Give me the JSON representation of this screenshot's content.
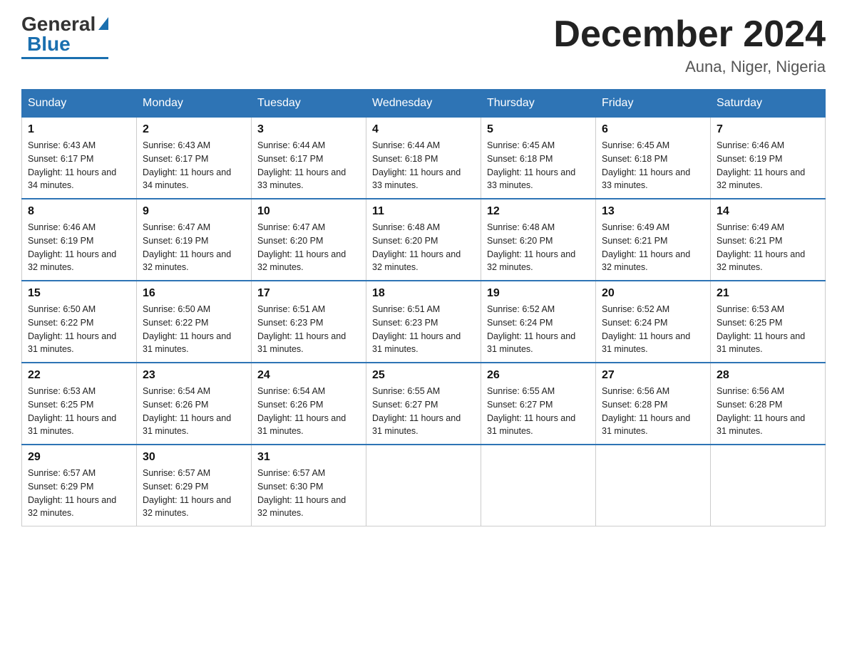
{
  "header": {
    "logo_general": "General",
    "logo_blue": "Blue",
    "title": "December 2024",
    "subtitle": "Auna, Niger, Nigeria"
  },
  "days_of_week": [
    "Sunday",
    "Monday",
    "Tuesday",
    "Wednesday",
    "Thursday",
    "Friday",
    "Saturday"
  ],
  "weeks": [
    [
      {
        "day": "1",
        "sunrise": "6:43 AM",
        "sunset": "6:17 PM",
        "daylight": "11 hours and 34 minutes."
      },
      {
        "day": "2",
        "sunrise": "6:43 AM",
        "sunset": "6:17 PM",
        "daylight": "11 hours and 34 minutes."
      },
      {
        "day": "3",
        "sunrise": "6:44 AM",
        "sunset": "6:17 PM",
        "daylight": "11 hours and 33 minutes."
      },
      {
        "day": "4",
        "sunrise": "6:44 AM",
        "sunset": "6:18 PM",
        "daylight": "11 hours and 33 minutes."
      },
      {
        "day": "5",
        "sunrise": "6:45 AM",
        "sunset": "6:18 PM",
        "daylight": "11 hours and 33 minutes."
      },
      {
        "day": "6",
        "sunrise": "6:45 AM",
        "sunset": "6:18 PM",
        "daylight": "11 hours and 33 minutes."
      },
      {
        "day": "7",
        "sunrise": "6:46 AM",
        "sunset": "6:19 PM",
        "daylight": "11 hours and 32 minutes."
      }
    ],
    [
      {
        "day": "8",
        "sunrise": "6:46 AM",
        "sunset": "6:19 PM",
        "daylight": "11 hours and 32 minutes."
      },
      {
        "day": "9",
        "sunrise": "6:47 AM",
        "sunset": "6:19 PM",
        "daylight": "11 hours and 32 minutes."
      },
      {
        "day": "10",
        "sunrise": "6:47 AM",
        "sunset": "6:20 PM",
        "daylight": "11 hours and 32 minutes."
      },
      {
        "day": "11",
        "sunrise": "6:48 AM",
        "sunset": "6:20 PM",
        "daylight": "11 hours and 32 minutes."
      },
      {
        "day": "12",
        "sunrise": "6:48 AM",
        "sunset": "6:20 PM",
        "daylight": "11 hours and 32 minutes."
      },
      {
        "day": "13",
        "sunrise": "6:49 AM",
        "sunset": "6:21 PM",
        "daylight": "11 hours and 32 minutes."
      },
      {
        "day": "14",
        "sunrise": "6:49 AM",
        "sunset": "6:21 PM",
        "daylight": "11 hours and 32 minutes."
      }
    ],
    [
      {
        "day": "15",
        "sunrise": "6:50 AM",
        "sunset": "6:22 PM",
        "daylight": "11 hours and 31 minutes."
      },
      {
        "day": "16",
        "sunrise": "6:50 AM",
        "sunset": "6:22 PM",
        "daylight": "11 hours and 31 minutes."
      },
      {
        "day": "17",
        "sunrise": "6:51 AM",
        "sunset": "6:23 PM",
        "daylight": "11 hours and 31 minutes."
      },
      {
        "day": "18",
        "sunrise": "6:51 AM",
        "sunset": "6:23 PM",
        "daylight": "11 hours and 31 minutes."
      },
      {
        "day": "19",
        "sunrise": "6:52 AM",
        "sunset": "6:24 PM",
        "daylight": "11 hours and 31 minutes."
      },
      {
        "day": "20",
        "sunrise": "6:52 AM",
        "sunset": "6:24 PM",
        "daylight": "11 hours and 31 minutes."
      },
      {
        "day": "21",
        "sunrise": "6:53 AM",
        "sunset": "6:25 PM",
        "daylight": "11 hours and 31 minutes."
      }
    ],
    [
      {
        "day": "22",
        "sunrise": "6:53 AM",
        "sunset": "6:25 PM",
        "daylight": "11 hours and 31 minutes."
      },
      {
        "day": "23",
        "sunrise": "6:54 AM",
        "sunset": "6:26 PM",
        "daylight": "11 hours and 31 minutes."
      },
      {
        "day": "24",
        "sunrise": "6:54 AM",
        "sunset": "6:26 PM",
        "daylight": "11 hours and 31 minutes."
      },
      {
        "day": "25",
        "sunrise": "6:55 AM",
        "sunset": "6:27 PM",
        "daylight": "11 hours and 31 minutes."
      },
      {
        "day": "26",
        "sunrise": "6:55 AM",
        "sunset": "6:27 PM",
        "daylight": "11 hours and 31 minutes."
      },
      {
        "day": "27",
        "sunrise": "6:56 AM",
        "sunset": "6:28 PM",
        "daylight": "11 hours and 31 minutes."
      },
      {
        "day": "28",
        "sunrise": "6:56 AM",
        "sunset": "6:28 PM",
        "daylight": "11 hours and 31 minutes."
      }
    ],
    [
      {
        "day": "29",
        "sunrise": "6:57 AM",
        "sunset": "6:29 PM",
        "daylight": "11 hours and 32 minutes."
      },
      {
        "day": "30",
        "sunrise": "6:57 AM",
        "sunset": "6:29 PM",
        "daylight": "11 hours and 32 minutes."
      },
      {
        "day": "31",
        "sunrise": "6:57 AM",
        "sunset": "6:30 PM",
        "daylight": "11 hours and 32 minutes."
      },
      null,
      null,
      null,
      null
    ]
  ],
  "labels": {
    "sunrise": "Sunrise:",
    "sunset": "Sunset:",
    "daylight": "Daylight:"
  }
}
